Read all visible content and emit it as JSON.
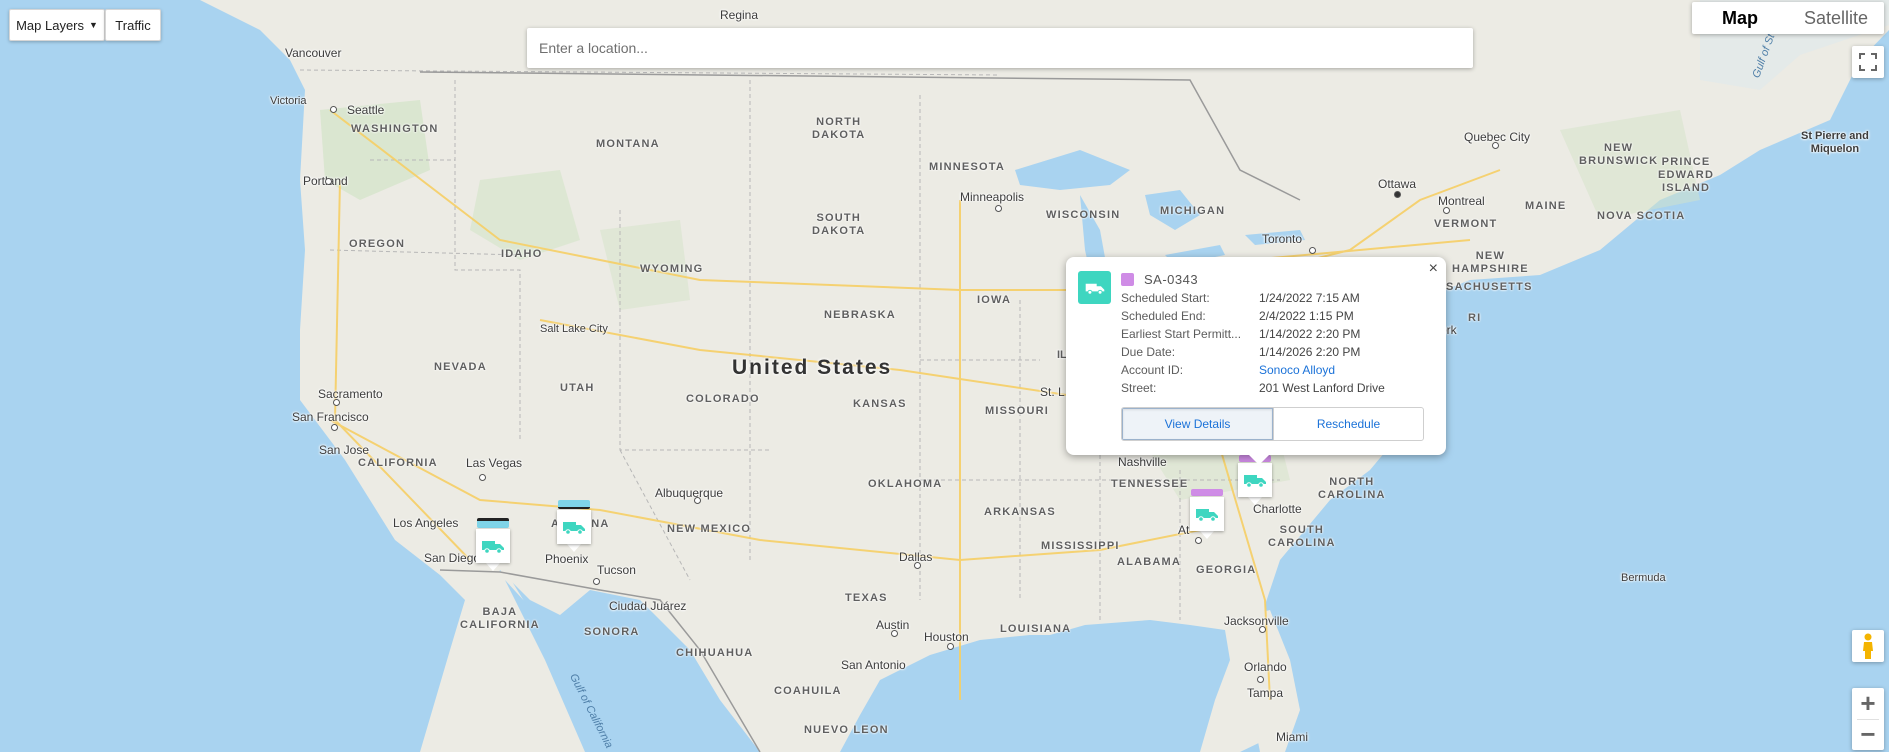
{
  "toolbar": {
    "map_layers_label": "Map Layers",
    "traffic_label": "Traffic"
  },
  "search": {
    "placeholder": "Enter a location..."
  },
  "map_type": {
    "map_label": "Map",
    "satellite_label": "Satellite"
  },
  "country_label": "United States",
  "states": [
    {
      "key": "washington",
      "label": "WASHINGTON"
    },
    {
      "key": "oregon",
      "label": "OREGON"
    },
    {
      "key": "idaho",
      "label": "IDAHO"
    },
    {
      "key": "montana",
      "label": "MONTANA"
    },
    {
      "key": "wyoming",
      "label": "WYOMING"
    },
    {
      "key": "nevada",
      "label": "NEVADA"
    },
    {
      "key": "utah",
      "label": "UTAH"
    },
    {
      "key": "california",
      "label": "CALIFORNIA"
    },
    {
      "key": "colorado",
      "label": "COLORADO"
    },
    {
      "key": "arizona",
      "label": "ARIZONA"
    },
    {
      "key": "new_mexico",
      "label": "NEW MEXICO"
    },
    {
      "key": "north_dakota",
      "label": "NORTH\nDAKOTA"
    },
    {
      "key": "south_dakota",
      "label": "SOUTH\nDAKOTA"
    },
    {
      "key": "nebraska",
      "label": "NEBRASKA"
    },
    {
      "key": "kansas",
      "label": "KANSAS"
    },
    {
      "key": "oklahoma",
      "label": "OKLAHOMA"
    },
    {
      "key": "texas",
      "label": "TEXAS"
    },
    {
      "key": "minnesota",
      "label": "MINNESOTA"
    },
    {
      "key": "iowa",
      "label": "IOWA"
    },
    {
      "key": "missouri",
      "label": "MISSOURI"
    },
    {
      "key": "arkansas",
      "label": "ARKANSAS"
    },
    {
      "key": "louisiana",
      "label": "LOUISIANA"
    },
    {
      "key": "wisconsin",
      "label": "WISCONSIN"
    },
    {
      "key": "michigan",
      "label": "MICHIGAN"
    },
    {
      "key": "tennessee",
      "label": "TENNESSEE"
    },
    {
      "key": "mississippi",
      "label": "MISSISSIPPI"
    },
    {
      "key": "alabama",
      "label": "ALABAMA"
    },
    {
      "key": "georgia",
      "label": "GEORGIA"
    },
    {
      "key": "south_carolina",
      "label": "SOUTH\nCAROLINA"
    },
    {
      "key": "north_carolina",
      "label": "NORTH\nCAROLINA"
    },
    {
      "key": "new_brunswick",
      "label": "NEW\nBRUNSWICK"
    },
    {
      "key": "maine",
      "label": "MAINE"
    },
    {
      "key": "vermont",
      "label": "VERMONT"
    },
    {
      "key": "new_hampshire",
      "label": "NEW\nHAMPSHIRE"
    },
    {
      "key": "massachusetts",
      "label": "MASSACHUSETTS"
    },
    {
      "key": "ri",
      "label": "RI"
    },
    {
      "key": "nova_scotia",
      "label": "NOVA SCOTIA"
    },
    {
      "key": "pei",
      "label": "PRINCE\nEDWARD\nISLAND"
    },
    {
      "key": "baja",
      "label": "BAJA\nCALIFORNIA"
    },
    {
      "key": "sonora",
      "label": "SONORA"
    },
    {
      "key": "chihuahua",
      "label": "CHIHUAHUA"
    },
    {
      "key": "coahuila",
      "label": "COAHUILA"
    },
    {
      "key": "nuevo_leon",
      "label": "NUEVO LEON"
    }
  ],
  "cities": [
    {
      "key": "vancouver",
      "label": "Vancouver"
    },
    {
      "key": "victoria",
      "label": "Victoria"
    },
    {
      "key": "seattle",
      "label": "Seattle"
    },
    {
      "key": "portland",
      "label": "Portland"
    },
    {
      "key": "regina",
      "label": "Regina"
    },
    {
      "key": "sacramento",
      "label": "Sacramento"
    },
    {
      "key": "san_francisco",
      "label": "San Francisco"
    },
    {
      "key": "san_jose",
      "label": "San Jose"
    },
    {
      "key": "las_vegas",
      "label": "Las Vegas"
    },
    {
      "key": "los_angeles",
      "label": "Los Angeles"
    },
    {
      "key": "san_diego",
      "label": "San Diego"
    },
    {
      "key": "phoenix",
      "label": "Phoenix"
    },
    {
      "key": "tucson",
      "label": "Tucson"
    },
    {
      "key": "salt_lake_city",
      "label": "Salt Lake City"
    },
    {
      "key": "albuquerque",
      "label": "Albuquerque"
    },
    {
      "key": "ciudad_juarez",
      "label": "Ciudad Juárez"
    },
    {
      "key": "dallas",
      "label": "Dallas"
    },
    {
      "key": "austin",
      "label": "Austin"
    },
    {
      "key": "houston",
      "label": "Houston"
    },
    {
      "key": "san_antonio",
      "label": "San Antonio"
    },
    {
      "key": "minneapolis",
      "label": "Minneapolis"
    },
    {
      "key": "st_louis",
      "label": "St. L"
    },
    {
      "key": "il",
      "label": "IL"
    },
    {
      "key": "nashville",
      "label": "Nashville"
    },
    {
      "key": "atlanta",
      "label": "At"
    },
    {
      "key": "charlotte",
      "label": "Charlotte"
    },
    {
      "key": "jacksonville",
      "label": "Jacksonville"
    },
    {
      "key": "orlando",
      "label": "Orlando"
    },
    {
      "key": "tampa",
      "label": "Tampa"
    },
    {
      "key": "miami",
      "label": "Miami"
    },
    {
      "key": "toronto",
      "label": "Toronto"
    },
    {
      "key": "ottawa",
      "label": "Ottawa"
    },
    {
      "key": "montreal",
      "label": "Montreal"
    },
    {
      "key": "quebec_city",
      "label": "Quebec City"
    },
    {
      "key": "york",
      "label": "ork"
    },
    {
      "key": "st_pierre",
      "label": "St Pierre and\nMiquelon"
    },
    {
      "key": "bermuda",
      "label": "Bermuda"
    },
    {
      "key": "gulf_california",
      "label": "Gulf of California"
    },
    {
      "key": "gulf_st",
      "label": "Gulf of St"
    }
  ],
  "markers": [
    {
      "key": "la",
      "bar_color": "#7fd4e8"
    },
    {
      "key": "phoenix",
      "bar_color": "#7fd4e8"
    },
    {
      "key": "atlanta",
      "bar_color": "#cf8ce6"
    },
    {
      "key": "charlotte",
      "bar_color": "#cf8ce6"
    }
  ],
  "popup": {
    "title": "SA-0343",
    "swatch_color": "#cf8ce6",
    "icon": "truck-icon",
    "fields": [
      {
        "label": "Scheduled Start:",
        "value": "1/24/2022 7:15 AM",
        "link": false
      },
      {
        "label": "Scheduled End:",
        "value": "2/4/2022 1:15 PM",
        "link": false
      },
      {
        "label": "Earliest Start Permitt...",
        "value": "1/14/2022 2:20 PM",
        "link": false
      },
      {
        "label": "Due Date:",
        "value": "1/14/2026 2:20 PM",
        "link": false
      },
      {
        "label": "Account ID:",
        "value": "Sonoco Alloyd",
        "link": true
      },
      {
        "label": "Street:",
        "value": "201 West Lanford Drive",
        "link": false
      }
    ],
    "view_details_label": "View Details",
    "reschedule_label": "Reschedule",
    "close_label": "×"
  },
  "colors": {
    "water": "#a9d3f0",
    "land": "#ecebe4",
    "accent": "#1b72d8",
    "marker_teal": "#3ed6c0"
  }
}
